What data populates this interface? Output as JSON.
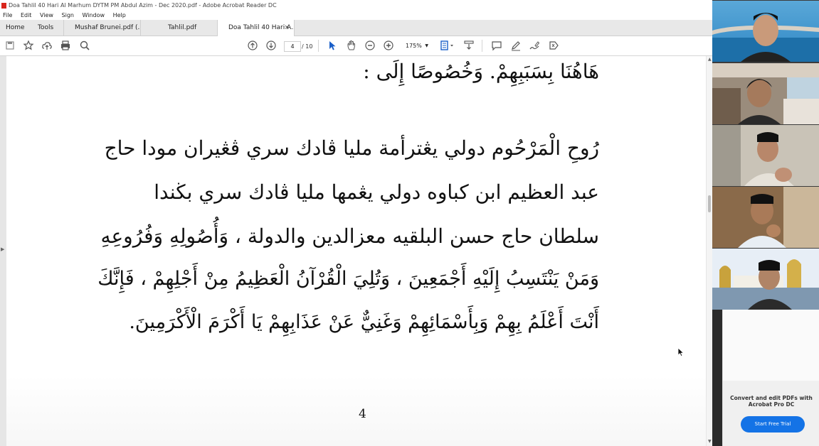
{
  "window": {
    "title": "Doa Tahlil 40 Hari Al Marhum DYTM PM Abdul Azim - Dec 2020.pdf - Adobe Acrobat Reader DC"
  },
  "menu": [
    "File",
    "Edit",
    "View",
    "Sign",
    "Window",
    "Help"
  ],
  "tabs": [
    {
      "label": "Home"
    },
    {
      "label": "Tools"
    },
    {
      "label": "Mushaf Brunei.pdf (..."
    },
    {
      "label": "Tahlil.pdf"
    },
    {
      "label": "Doa Tahlil 40 Hari A...",
      "active": true,
      "close": "×"
    }
  ],
  "toolbar": {
    "current_page": "4",
    "page_of": "/ 10",
    "zoom": "175%"
  },
  "document": {
    "lines": [
      "هَاهُنَا بِسَبَبِهِمْ. وَخُصُوصًا إِلَى :",
      "رُوحِ الْمَرْحُوم دولي يڠترأمة مليا ڤادك سري ڤڠيران مودا حاج",
      "عبد العظيم ابن كباوه دولي يڠمها مليا ڤادك سري بڬندا",
      "سلطان حاج حسن البلقيه معزالدين والدولة ، وَأُصُولِهِ وَفُرُوعِهِ",
      "وَمَنْ يَنْتَسِبُ إِلَيْهِ أَجْمَعِينَ ، وَتُلِيَ الْقُرْآنُ الْعَظِيمُ مِنْ أَجْلِهِمْ ، فَإِنَّكَ",
      "أَنْتَ أَعْلَمُ بِهِمْ وَبِأَسْمَائِهِمْ وَغَنِيٌّ عَنْ عَذَابِهِمْ يَا أَكْرَمَ الْأَكْرَمِينَ."
    ],
    "page_number": "4"
  },
  "promo": {
    "text": "Convert and edit PDFs with Acrobat Pro DC",
    "button": "Start Free Trial"
  },
  "colors": {
    "accent": "#1473e6",
    "acrobat_red": "#d9251c"
  }
}
